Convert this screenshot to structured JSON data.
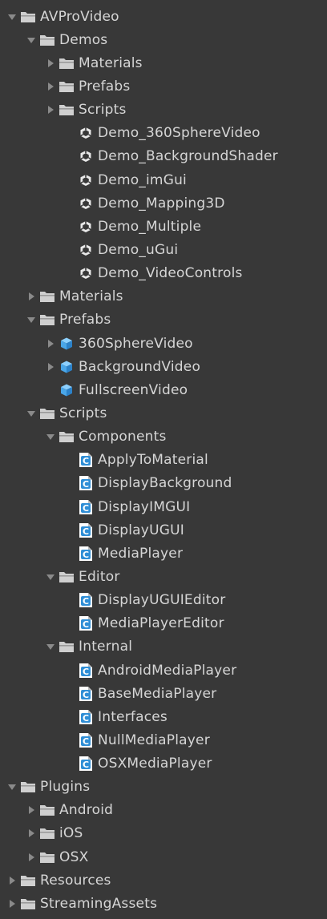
{
  "tree": {
    "items": [
      {
        "label": "AVProVideo",
        "type": "folder",
        "depth": 0,
        "arrow": "open"
      },
      {
        "label": "Demos",
        "type": "folder",
        "depth": 1,
        "arrow": "open"
      },
      {
        "label": "Materials",
        "type": "folder",
        "depth": 2,
        "arrow": "closed"
      },
      {
        "label": "Prefabs",
        "type": "folder",
        "depth": 2,
        "arrow": "closed"
      },
      {
        "label": "Scripts",
        "type": "folder",
        "depth": 2,
        "arrow": "closed"
      },
      {
        "label": "Demo_360SphereVideo",
        "type": "unity",
        "depth": 3,
        "arrow": "none"
      },
      {
        "label": "Demo_BackgroundShader",
        "type": "unity",
        "depth": 3,
        "arrow": "none"
      },
      {
        "label": "Demo_imGui",
        "type": "unity",
        "depth": 3,
        "arrow": "none"
      },
      {
        "label": "Demo_Mapping3D",
        "type": "unity",
        "depth": 3,
        "arrow": "none"
      },
      {
        "label": "Demo_Multiple",
        "type": "unity",
        "depth": 3,
        "arrow": "none"
      },
      {
        "label": "Demo_uGui",
        "type": "unity",
        "depth": 3,
        "arrow": "none"
      },
      {
        "label": "Demo_VideoControls",
        "type": "unity",
        "depth": 3,
        "arrow": "none"
      },
      {
        "label": "Materials",
        "type": "folder",
        "depth": 1,
        "arrow": "closed"
      },
      {
        "label": "Prefabs",
        "type": "folder",
        "depth": 1,
        "arrow": "open"
      },
      {
        "label": "360SphereVideo",
        "type": "prefab",
        "depth": 2,
        "arrow": "closed"
      },
      {
        "label": "BackgroundVideo",
        "type": "prefab",
        "depth": 2,
        "arrow": "closed"
      },
      {
        "label": "FullscreenVideo",
        "type": "prefab",
        "depth": 2,
        "arrow": "none"
      },
      {
        "label": "Scripts",
        "type": "folder",
        "depth": 1,
        "arrow": "open"
      },
      {
        "label": "Components",
        "type": "folder",
        "depth": 2,
        "arrow": "open"
      },
      {
        "label": "ApplyToMaterial",
        "type": "script",
        "depth": 3,
        "arrow": "none"
      },
      {
        "label": "DisplayBackground",
        "type": "script",
        "depth": 3,
        "arrow": "none"
      },
      {
        "label": "DisplayIMGUI",
        "type": "script",
        "depth": 3,
        "arrow": "none"
      },
      {
        "label": "DisplayUGUI",
        "type": "script",
        "depth": 3,
        "arrow": "none"
      },
      {
        "label": "MediaPlayer",
        "type": "script",
        "depth": 3,
        "arrow": "none"
      },
      {
        "label": "Editor",
        "type": "folder",
        "depth": 2,
        "arrow": "open"
      },
      {
        "label": "DisplayUGUIEditor",
        "type": "script",
        "depth": 3,
        "arrow": "none"
      },
      {
        "label": "MediaPlayerEditor",
        "type": "script",
        "depth": 3,
        "arrow": "none"
      },
      {
        "label": "Internal",
        "type": "folder",
        "depth": 2,
        "arrow": "open"
      },
      {
        "label": "AndroidMediaPlayer",
        "type": "script",
        "depth": 3,
        "arrow": "none"
      },
      {
        "label": "BaseMediaPlayer",
        "type": "script",
        "depth": 3,
        "arrow": "none"
      },
      {
        "label": "Interfaces",
        "type": "script",
        "depth": 3,
        "arrow": "none"
      },
      {
        "label": "NullMediaPlayer",
        "type": "script",
        "depth": 3,
        "arrow": "none"
      },
      {
        "label": "OSXMediaPlayer",
        "type": "script",
        "depth": 3,
        "arrow": "none"
      },
      {
        "label": "Plugins",
        "type": "folder",
        "depth": 0,
        "arrow": "open"
      },
      {
        "label": "Android",
        "type": "folder",
        "depth": 1,
        "arrow": "closed"
      },
      {
        "label": "iOS",
        "type": "folder",
        "depth": 1,
        "arrow": "closed"
      },
      {
        "label": "OSX",
        "type": "folder",
        "depth": 1,
        "arrow": "closed"
      },
      {
        "label": "Resources",
        "type": "folder",
        "depth": 0,
        "arrow": "closed"
      },
      {
        "label": "StreamingAssets",
        "type": "folder",
        "depth": 0,
        "arrow": "closed"
      }
    ]
  },
  "colors": {
    "background": "#383838",
    "text": "#d6d6d6",
    "arrow": "#8a8a8a",
    "folder": "#cfcfcf",
    "prefab": "#4aa6e8",
    "script_icon": "#2f8ed6"
  }
}
